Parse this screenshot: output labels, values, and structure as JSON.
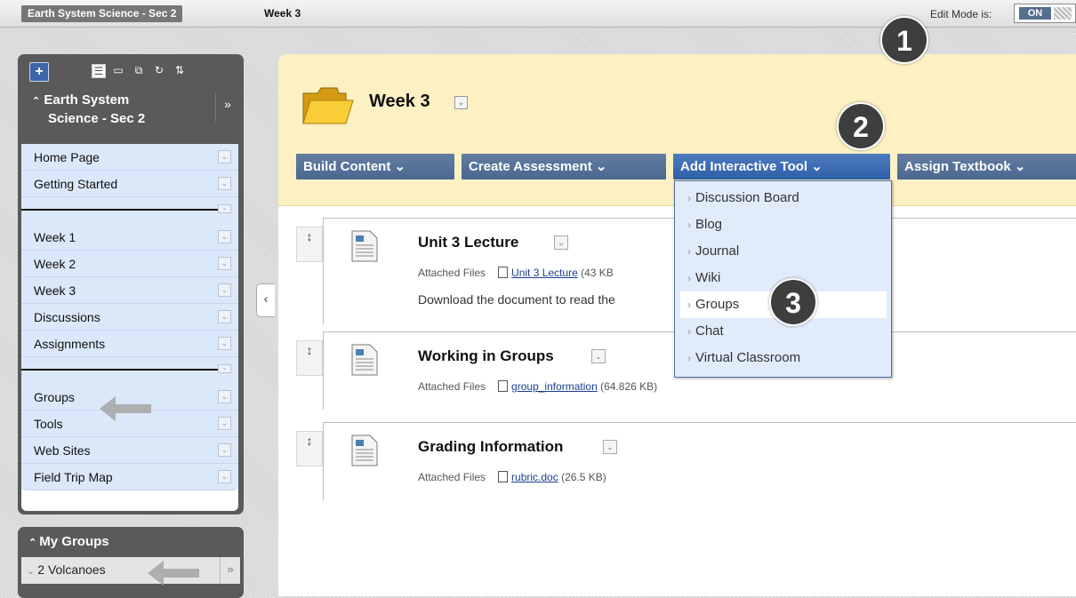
{
  "breadcrumb": {
    "course": "Earth System Science - Sec 2",
    "page": "Week 3"
  },
  "edit_mode": {
    "label": "Edit Mode is:",
    "state": "ON"
  },
  "sidebar": {
    "add_button": "+",
    "title": "Earth System Science - Sec 2",
    "title_line1": "Earth System",
    "title_line2": "Science - Sec 2",
    "items": [
      "Home Page",
      "Getting Started",
      "Week 1",
      "Week 2",
      "Week 3",
      "Discussions",
      "Assignments",
      "Groups",
      "Tools",
      "Web Sites",
      "Field Trip Map"
    ]
  },
  "my_groups": {
    "title": "My Groups",
    "item": "2 Volcanoes"
  },
  "page": {
    "title": "Week 3"
  },
  "actions": [
    "Build Content",
    "Create Assessment",
    "Add Interactive Tool",
    "Assign Textbook"
  ],
  "dropdown": [
    "Discussion Board",
    "Blog",
    "Journal",
    "Wiki",
    "Groups",
    "Chat",
    "Virtual Classroom"
  ],
  "content": [
    {
      "title": "Unit 3 Lecture",
      "files_label": "Attached Files",
      "file": "Unit 3 Lecture",
      "size": "(43 KB",
      "desc": "Download the document to read the"
    },
    {
      "title": "Working in Groups",
      "files_label": "Attached Files",
      "file": "group_information",
      "size": "(64.826 KB)"
    },
    {
      "title": "Grading Information",
      "files_label": "Attached Files",
      "file": "rubric.doc",
      "size": "(26.5 KB)"
    }
  ],
  "callouts": [
    "1",
    "2",
    "3"
  ],
  "colors": {
    "action_button": "#4b6890",
    "header_bg": "#fdf0c3",
    "sidebar_item_bg": "#dbe8fa",
    "dropdown_bg": "#e1ecfb"
  }
}
